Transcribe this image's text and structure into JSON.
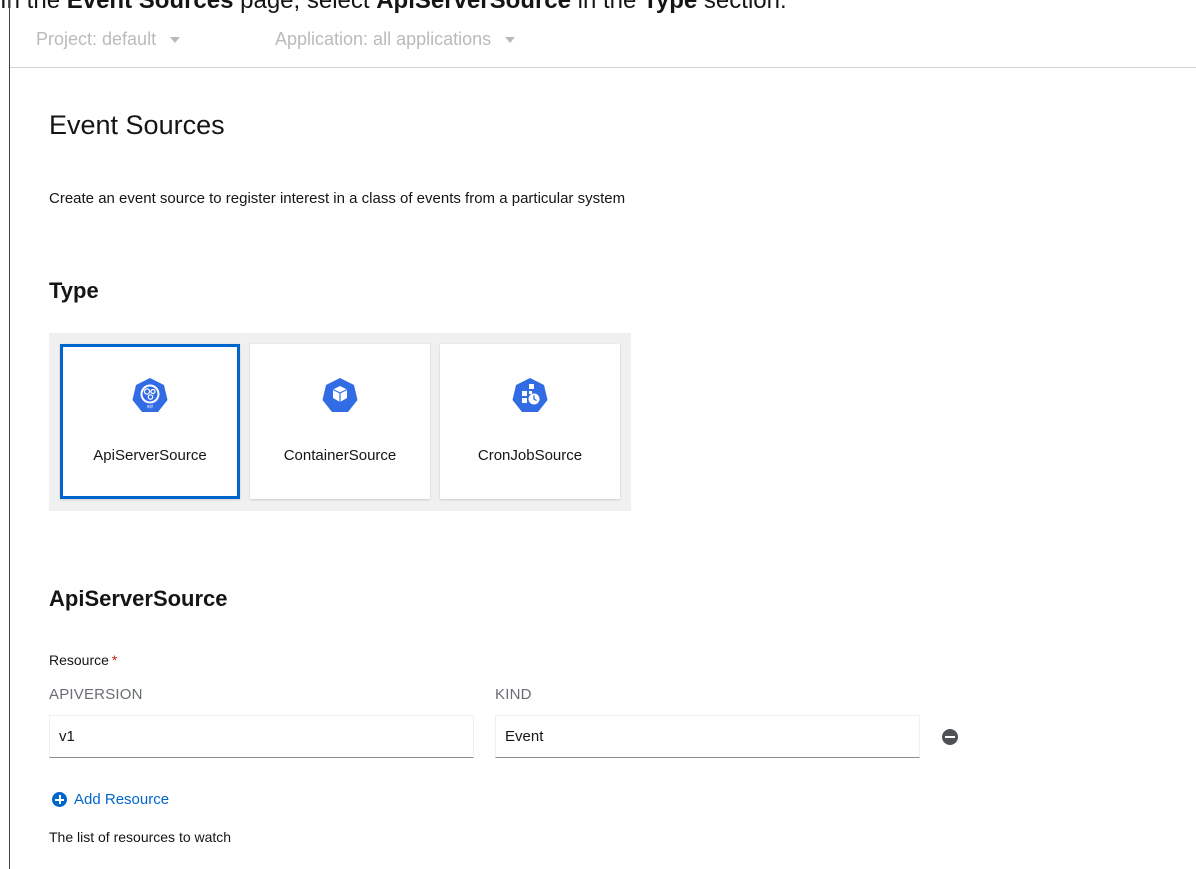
{
  "instruction": {
    "prefix": "In the ",
    "page_name": "Event Sources",
    "middle": " page, select ",
    "item": "ApiServerSource",
    "in_the": " in the ",
    "section": "Type",
    "suffix": " section."
  },
  "context_bar": {
    "project": "Project: default",
    "application": "Application: all applications"
  },
  "page": {
    "title": "Event Sources",
    "description": "Create an event source to register interest in a class of events from a particular system"
  },
  "type_section": {
    "heading": "Type",
    "tiles": [
      {
        "label": "ApiServerSource",
        "icon": "apiserversource-icon",
        "selected": true
      },
      {
        "label": "ContainerSource",
        "icon": "containersource-icon",
        "selected": false
      },
      {
        "label": "CronJobSource",
        "icon": "cronjobsource-icon",
        "selected": false
      }
    ]
  },
  "form": {
    "heading": "ApiServerSource",
    "resource_label": "Resource",
    "required_marker": "*",
    "apiversion_label": "APIVERSION",
    "kind_label": "KIND",
    "apiversion_value": "v1",
    "kind_value": "Event",
    "add_resource": "Add Resource",
    "helper": "The list of resources to watch"
  },
  "colors": {
    "accent": "#0066cc",
    "icon_blue": "#326ce5",
    "required": "#c9190b"
  }
}
